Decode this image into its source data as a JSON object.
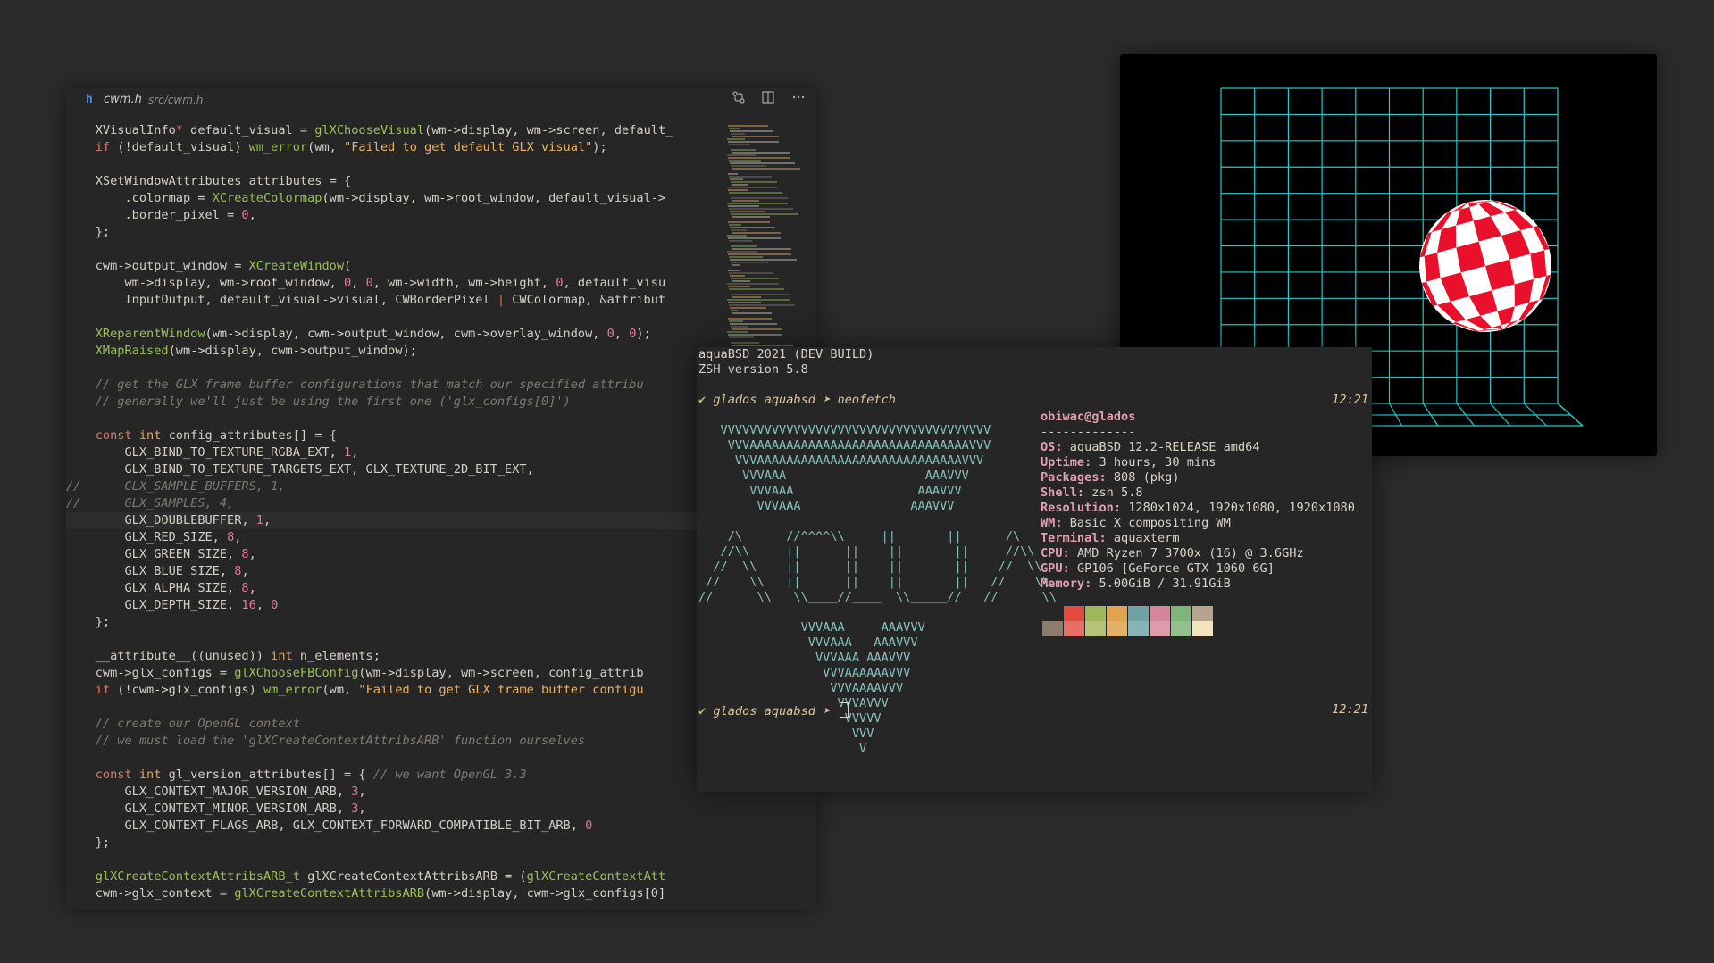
{
  "editor": {
    "file_icon": "h",
    "file_name": "cwm.h",
    "file_path": "src/cwm.h",
    "toolbar_icons": [
      "source-control-icon",
      "split-editor-icon",
      "more-icon"
    ],
    "lines": [
      [
        [
          "pl",
          "    XVisualInfo"
        ],
        [
          "op",
          "*"
        ],
        [
          "pl",
          " default_visual = "
        ],
        [
          "fn",
          "glXChooseVisual"
        ],
        [
          "pl",
          "(wm->display, wm->screen, default_"
        ]
      ],
      [
        [
          "pl",
          "    "
        ],
        [
          "kw",
          "if"
        ],
        [
          "pl",
          " (!default_visual) "
        ],
        [
          "fn",
          "wm_error"
        ],
        [
          "pl",
          "(wm, "
        ],
        [
          "str",
          "\"Failed to get default GLX visual\""
        ],
        [
          "pl",
          ");"
        ]
      ],
      [],
      [
        [
          "pl",
          "    XSetWindowAttributes attributes = {"
        ]
      ],
      [
        [
          "pl",
          "        .colormap = "
        ],
        [
          "fn",
          "XCreateColormap"
        ],
        [
          "pl",
          "(wm->display, wm->root_window, default_visual->"
        ]
      ],
      [
        [
          "pl",
          "        .border_pixel = "
        ],
        [
          "num",
          "0"
        ],
        [
          "pl",
          ","
        ]
      ],
      [
        [
          "pl",
          "    };"
        ]
      ],
      [],
      [
        [
          "pl",
          "    cwm->output_window = "
        ],
        [
          "fn",
          "XCreateWindow"
        ],
        [
          "pl",
          "("
        ]
      ],
      [
        [
          "pl",
          "        wm->display, wm->root_window, "
        ],
        [
          "num",
          "0"
        ],
        [
          "pl",
          ", "
        ],
        [
          "num",
          "0"
        ],
        [
          "pl",
          ", wm->width, wm->height, "
        ],
        [
          "num",
          "0"
        ],
        [
          "pl",
          ", default_visu"
        ]
      ],
      [
        [
          "pl",
          "        InputOutput, default_visual->visual, CWBorderPixel "
        ],
        [
          "op",
          "|"
        ],
        [
          "pl",
          " CWColormap, &attribut"
        ]
      ],
      [],
      [
        [
          "pl",
          "    "
        ],
        [
          "fn",
          "XReparentWindow"
        ],
        [
          "pl",
          "(wm->display, cwm->output_window, cwm->overlay_window, "
        ],
        [
          "num",
          "0"
        ],
        [
          "pl",
          ", "
        ],
        [
          "num",
          "0"
        ],
        [
          "pl",
          ");"
        ]
      ],
      [
        [
          "pl",
          "    "
        ],
        [
          "fn",
          "XMapRaised"
        ],
        [
          "pl",
          "(wm->display, cwm->output_window);"
        ]
      ],
      [],
      [
        [
          "cmt",
          "    // get the GLX frame buffer configurations that match our specified attribu"
        ]
      ],
      [
        [
          "cmt",
          "    // generally we'll just be using the first one ('glx_configs[0]')"
        ]
      ],
      [],
      [
        [
          "pl",
          "    "
        ],
        [
          "kw",
          "const"
        ],
        [
          "pl",
          " "
        ],
        [
          "type",
          "int"
        ],
        [
          "pl",
          " config_attributes[] = {"
        ]
      ],
      [
        [
          "pl",
          "        GLX_BIND_TO_TEXTURE_RGBA_EXT, "
        ],
        [
          "num",
          "1"
        ],
        [
          "pl",
          ","
        ]
      ],
      [
        [
          "pl",
          "        GLX_BIND_TO_TEXTURE_TARGETS_EXT, GLX_TEXTURE_2D_BIT_EXT,"
        ]
      ],
      [
        [
          "cmt",
          "//      GLX_SAMPLE_BUFFERS, 1,"
        ]
      ],
      [
        [
          "cmt",
          "//      GLX_SAMPLES, 4,"
        ]
      ],
      [
        [
          "pl",
          "        GLX_DOUBLEBUFFER, "
        ],
        [
          "num",
          "1"
        ],
        [
          "pl",
          ","
        ]
      ],
      [
        [
          "pl",
          "        GLX_RED_SIZE, "
        ],
        [
          "num",
          "8"
        ],
        [
          "pl",
          ","
        ]
      ],
      [
        [
          "pl",
          "        GLX_GREEN_SIZE, "
        ],
        [
          "num",
          "8"
        ],
        [
          "pl",
          ","
        ]
      ],
      [
        [
          "pl",
          "        GLX_BLUE_SIZE, "
        ],
        [
          "num",
          "8"
        ],
        [
          "pl",
          ","
        ]
      ],
      [
        [
          "pl",
          "        GLX_ALPHA_SIZE, "
        ],
        [
          "num",
          "8"
        ],
        [
          "pl",
          ","
        ]
      ],
      [
        [
          "pl",
          "        GLX_DEPTH_SIZE, "
        ],
        [
          "num",
          "16"
        ],
        [
          "pl",
          ", "
        ],
        [
          "num",
          "0"
        ]
      ],
      [
        [
          "pl",
          "    };"
        ]
      ],
      [],
      [
        [
          "pl",
          "    __attribute__((unused)) "
        ],
        [
          "type",
          "int"
        ],
        [
          "pl",
          " n_elements;"
        ]
      ],
      [
        [
          "pl",
          "    cwm->glx_configs = "
        ],
        [
          "fn",
          "glXChooseFBConfig"
        ],
        [
          "pl",
          "(wm->display, wm->screen, config_attrib"
        ]
      ],
      [
        [
          "pl",
          "    "
        ],
        [
          "kw",
          "if"
        ],
        [
          "pl",
          " (!cwm->glx_configs) "
        ],
        [
          "fn",
          "wm_error"
        ],
        [
          "pl",
          "(wm, "
        ],
        [
          "str",
          "\"Failed to get GLX frame buffer configu"
        ]
      ],
      [],
      [
        [
          "cmt",
          "    // create our OpenGL context"
        ]
      ],
      [
        [
          "cmt",
          "    // we must load the 'glXCreateContextAttribsARB' function ourselves"
        ]
      ],
      [],
      [
        [
          "pl",
          "    "
        ],
        [
          "kw",
          "const"
        ],
        [
          "pl",
          " "
        ],
        [
          "type",
          "int"
        ],
        [
          "pl",
          " gl_version_attributes[] = { "
        ],
        [
          "cmt",
          "// we want OpenGL 3.3"
        ]
      ],
      [
        [
          "pl",
          "        GLX_CONTEXT_MAJOR_VERSION_ARB, "
        ],
        [
          "num",
          "3"
        ],
        [
          "pl",
          ","
        ]
      ],
      [
        [
          "pl",
          "        GLX_CONTEXT_MINOR_VERSION_ARB, "
        ],
        [
          "num",
          "3"
        ],
        [
          "pl",
          ","
        ]
      ],
      [
        [
          "pl",
          "        GLX_CONTEXT_FLAGS_ARB, GLX_CONTEXT_FORWARD_COMPATIBLE_BIT_ARB, "
        ],
        [
          "num",
          "0"
        ]
      ],
      [
        [
          "pl",
          "    };"
        ]
      ],
      [],
      [
        [
          "pl",
          "    "
        ],
        [
          "fn",
          "glXCreateContextAttribsARB_t"
        ],
        [
          "pl",
          " glXCreateContextAttribsARB = ("
        ],
        [
          "fn",
          "glXCreateContextAtt"
        ]
      ],
      [
        [
          "pl",
          "    cwm->glx_context = "
        ],
        [
          "fn",
          "glXCreateContextAttribsARB"
        ],
        [
          "pl",
          "(wm->display, cwm->glx_configs[0]"
        ]
      ]
    ],
    "highlighted_line": 23
  },
  "terminal": {
    "header": [
      "aquaBSD 2021 (DEV BUILD)",
      "ZSH version 5.8"
    ],
    "prompt_mark": "✔",
    "prompt1": "glados aquabsd ➤ neofetch",
    "prompt2": "glados aquabsd ➤ ",
    "time1": "12:21",
    "time2": "12:21",
    "ascii": [
      "   VVVVVVVVVVVVVVVVVVVVVVVVVVVVVVVVVVVVV",
      "    VVVAAAAAAAAAAAAAAAAAAAAAAAAAAAAAAVVV",
      "     VVVAAAAAAAAAAAAAAAAAAAAAAAAAAAAVVV",
      "      VVVAAA                   AAAVVV",
      "       VVVAAA                 AAAVVV",
      "        VVVAAA               AAAVVV",
      "",
      "    /\\      //^^^^\\\\     ||       ||      /\\",
      "   //\\\\     ||      ||    ||       ||     //\\\\",
      "  //  \\\\    ||      ||    ||       ||    //  \\\\",
      " //    \\\\   ||      ||    ||       ||   //    \\\\",
      "//      \\\\   \\\\____//____  \\\\_____//   //      \\\\",
      "",
      "              VVVAAA     AAAVVV",
      "               VVVAAA   AAAVVV",
      "                VVVAAA AAAVVV",
      "                 VVVAAAAAAVVV",
      "                  VVVAAAAVVV",
      "                   VVVAVVV",
      "                    VVVVV",
      "                     VVV",
      "                      V"
    ],
    "user_host": "obiwac@glados",
    "separator": "-------------",
    "info": [
      {
        "key": "OS",
        "value": "aquaBSD 12.2-RELEASE amd64"
      },
      {
        "key": "Uptime",
        "value": "3 hours, 30 mins"
      },
      {
        "key": "Packages",
        "value": "808 (pkg)"
      },
      {
        "key": "Shell",
        "value": "zsh 5.8"
      },
      {
        "key": "Resolution",
        "value": "1280x1024, 1920x1080, 1920x1080"
      },
      {
        "key": "WM",
        "value": "Basic X compositing WM"
      },
      {
        "key": "Terminal",
        "value": "aquaxterm"
      },
      {
        "key": "CPU",
        "value": "AMD Ryzen 7 3700x (16) @ 3.6GHz"
      },
      {
        "key": "GPU",
        "value": "GP106 [GeForce GTX 1060 6G]"
      },
      {
        "key": "Memory",
        "value": "5.00GiB / 31.91GiB"
      }
    ],
    "palette_top": [
      "#262626",
      "#e24b3e",
      "#9fb65a",
      "#e0a350",
      "#6fa3a5",
      "#d4879a",
      "#7fb47a",
      "#b5a48e"
    ],
    "palette_bottom": [
      "#8a7d6e",
      "#e77064",
      "#b4c474",
      "#e4b068",
      "#87b5b5",
      "#de9cab",
      "#93c08c",
      "#f3e2c0"
    ]
  },
  "render": {
    "grid_color": "#25c9c9",
    "ball_colors": [
      "#e8102a",
      "#ffffff"
    ]
  }
}
